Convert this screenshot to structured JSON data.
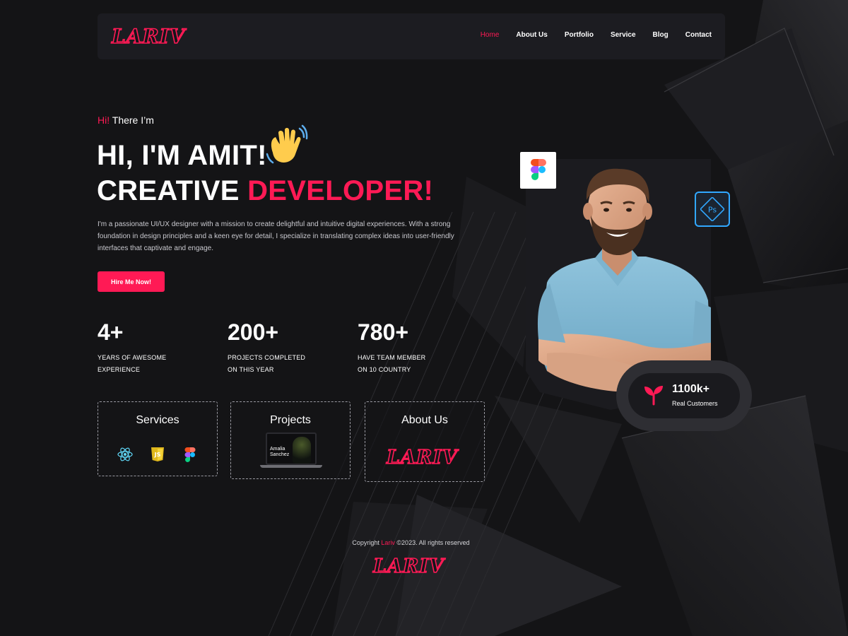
{
  "brand": {
    "logo_text": "LARIV",
    "accent_color": "#ff1a55",
    "background_color": "#141416"
  },
  "nav": {
    "items": [
      {
        "label": "Home",
        "active": true
      },
      {
        "label": "About Us",
        "active": false
      },
      {
        "label": "Portfolio",
        "active": false
      },
      {
        "label": "Service",
        "active": false
      },
      {
        "label": "Blog",
        "active": false
      },
      {
        "label": "Contact",
        "active": false
      }
    ]
  },
  "hero": {
    "greeting_accent": "Hi!",
    "greeting_rest": " There I’m",
    "headline_line1": "HI, I'M AMIT!",
    "headline_line2_white": "CREATIVE ",
    "headline_line2_accent": "DEVELOPER!",
    "wave_icon": "waving-hand-icon",
    "intro": "I'm a passionate UI/UX designer with a mission to create delightful and intuitive digital experiences. With a strong foundation in design principles and a keen eye for detail, I specialize in translating complex ideas into user-friendly interfaces that captivate and engage.",
    "cta_label": "Hire Me Now!"
  },
  "stats": [
    {
      "value": "4+",
      "label_line1": "YEARS OF AWESOME",
      "label_line2": "EXPERIENCE"
    },
    {
      "value": "200+",
      "label_line1": "PROJECTS COMPLETED",
      "label_line2": "ON THIS YEAR"
    },
    {
      "value": "780+",
      "label_line1": "HAVE TEAM MEMBER",
      "label_line2": "ON 10 COUNTRY"
    }
  ],
  "cards": {
    "services": {
      "title": "Services",
      "icons": [
        "react-icon",
        "js-icon",
        "figma-icon"
      ]
    },
    "projects": {
      "title": "Projects",
      "laptop_text_line1": "Amalia",
      "laptop_text_line2": "Sanchez"
    },
    "about": {
      "title": "About Us",
      "logo_text": "LARIV"
    }
  },
  "portrait": {
    "badges": [
      "figma-icon",
      "photoshop-icon"
    ],
    "ps_label": "Ps",
    "customers_value": "1100k+",
    "customers_label": "Real Customers",
    "customers_icon": "sprout-icon"
  },
  "footer": {
    "copyright_prefix": "Copyright ",
    "copyright_brand": "Lariv",
    "copyright_suffix": " ©2023. All rights reserved",
    "logo_text": "LARIV"
  }
}
